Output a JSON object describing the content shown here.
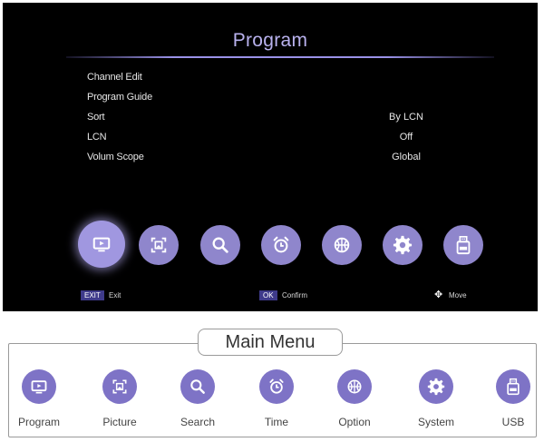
{
  "screen": {
    "title": "Program",
    "menu": [
      {
        "label": "Channel Edit",
        "value": ""
      },
      {
        "label": "Program Guide",
        "value": ""
      },
      {
        "label": "Sort",
        "value": "By LCN"
      },
      {
        "label": "LCN",
        "value": "Off"
      },
      {
        "label": "Volum Scope",
        "value": "Global"
      }
    ],
    "icons": [
      {
        "name": "program",
        "icon": "tv-screen-icon",
        "selected": true
      },
      {
        "name": "picture",
        "icon": "picture-frame-icon",
        "selected": false
      },
      {
        "name": "search",
        "icon": "magnifier-icon",
        "selected": false
      },
      {
        "name": "time",
        "icon": "alarm-clock-icon",
        "selected": false
      },
      {
        "name": "option",
        "icon": "basketball-icon",
        "selected": false
      },
      {
        "name": "system",
        "icon": "gear-icon",
        "selected": false
      },
      {
        "name": "usb",
        "icon": "usb-drive-icon",
        "selected": false
      }
    ],
    "status_bar": {
      "exit_key": "EXIT",
      "exit_label": "Exit",
      "ok_key": "OK",
      "ok_label": "Confirm",
      "move_label": "Move"
    }
  },
  "main_menu": {
    "title": "Main Menu",
    "items": [
      {
        "label": "Program",
        "icon": "tv-screen-icon"
      },
      {
        "label": "Picture",
        "icon": "picture-frame-icon"
      },
      {
        "label": "Search",
        "icon": "magnifier-icon"
      },
      {
        "label": "Time",
        "icon": "alarm-clock-icon"
      },
      {
        "label": "Option",
        "icon": "basketball-icon"
      },
      {
        "label": "System",
        "icon": "gear-icon"
      },
      {
        "label": "USB",
        "icon": "usb-drive-icon"
      }
    ]
  },
  "colors": {
    "accent": "#8f86cc",
    "accent_selected": "#a097e0",
    "title": "#b9b2ee",
    "key_badge": "#3e3a8a"
  }
}
